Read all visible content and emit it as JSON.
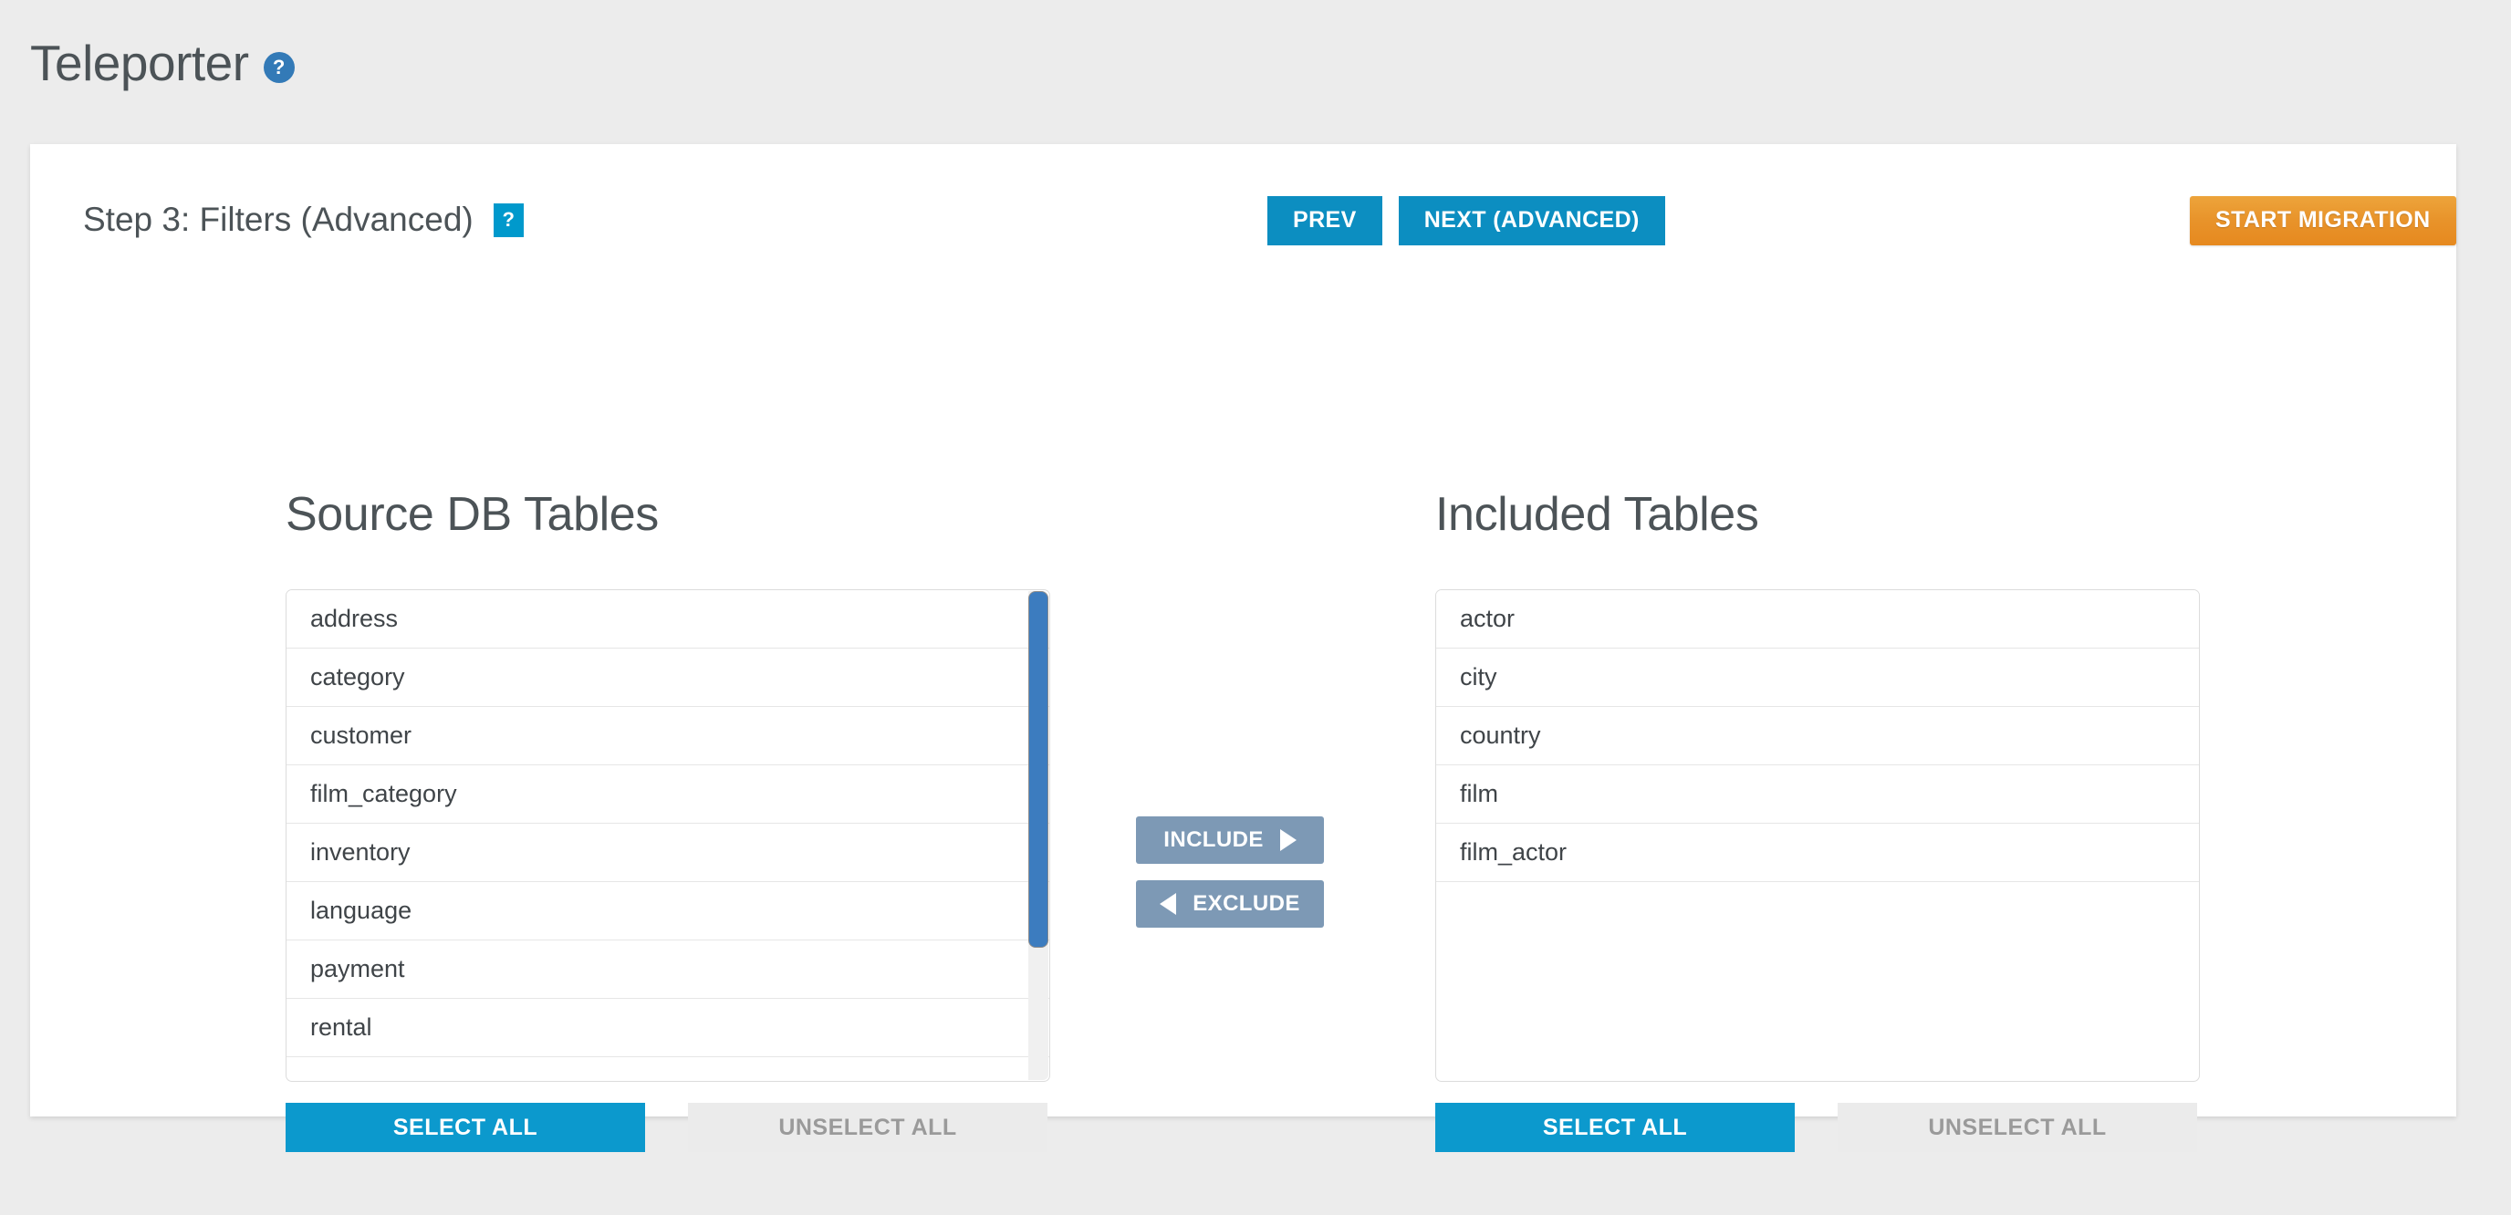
{
  "app": {
    "title": "Teleporter",
    "help_icon_label": "?"
  },
  "step": {
    "label": "Step 3: Filters (Advanced)",
    "help_badge_label": "?"
  },
  "nav": {
    "prev_label": "PREV",
    "next_label": "NEXT (ADVANCED)",
    "start_migration_label": "START MIGRATION"
  },
  "source_panel": {
    "heading": "Source DB Tables",
    "items": [
      {
        "label": "address"
      },
      {
        "label": "category"
      },
      {
        "label": "customer"
      },
      {
        "label": "film_category"
      },
      {
        "label": "inventory"
      },
      {
        "label": "language"
      },
      {
        "label": "payment"
      },
      {
        "label": "rental"
      }
    ],
    "select_all_label": "SELECT ALL",
    "unselect_all_label": "UNSELECT ALL"
  },
  "included_panel": {
    "heading": "Included Tables",
    "items": [
      {
        "label": "actor"
      },
      {
        "label": "city"
      },
      {
        "label": "country"
      },
      {
        "label": "film"
      },
      {
        "label": "film_actor"
      }
    ],
    "select_all_label": "SELECT ALL",
    "unselect_all_label": "UNSELECT ALL"
  },
  "transfer": {
    "include_label": "INCLUDE",
    "exclude_label": "EXCLUDE"
  },
  "colors": {
    "page_background": "#ececec",
    "card_background": "#ffffff",
    "accent_blue": "#0c8ec1",
    "accent_cyan": "#0c99cd",
    "accent_orange": "#e8932a",
    "transfer_slate": "#7d99b5",
    "scrollbar_thumb": "#3c7cbf",
    "help_circle": "#337ab7",
    "help_square": "#0099cc",
    "muted_button": "#ebebeb",
    "text_dark": "#4c5357"
  }
}
